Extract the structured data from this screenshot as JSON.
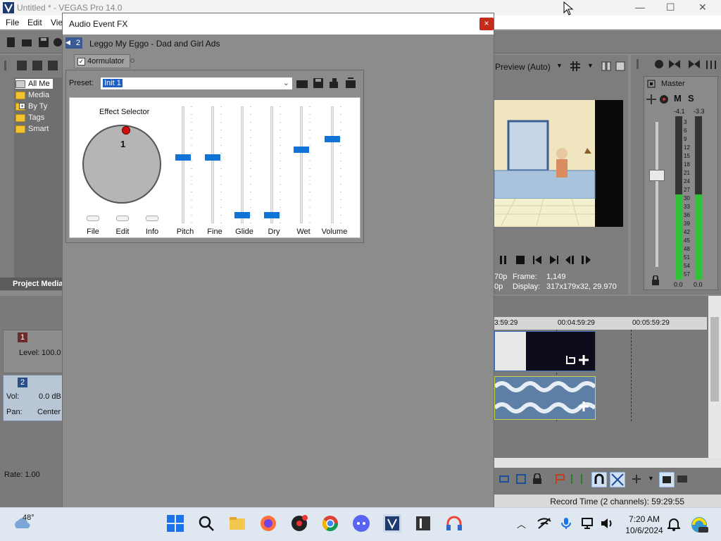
{
  "app": {
    "title": "Untitled * - VEGAS Pro 14.0",
    "menu": [
      "File",
      "Edit",
      "Vie"
    ]
  },
  "window_controls": {
    "minimize": "—",
    "maximize": "☐",
    "close": "✕"
  },
  "project_media": {
    "items": [
      "All Me",
      "Media",
      "By Ty",
      "Tags",
      "Smart"
    ],
    "label": "Project Media"
  },
  "tracks": [
    {
      "number": "1",
      "level_label": "Level:",
      "level_value": "100.0"
    },
    {
      "number": "2",
      "vol_label": "Vol:",
      "vol_value": "0.0 dB",
      "pan_label": "Pan:",
      "pan_value": "Center"
    }
  ],
  "rate": "Rate: 1.00",
  "preview": {
    "mode": "Preview (Auto)",
    "frame_label": "Frame:",
    "frame_value": "1,149",
    "display_label": "Display:",
    "display_value": "317x179x32, 29.970",
    "left_frag_1": "70p",
    "left_frag_2": "0p"
  },
  "master": {
    "title": "Master",
    "m_label": "M",
    "s_label": "S",
    "peak_left": "-4.1",
    "peak_right": "-3.3",
    "scale": [
      "3",
      "6",
      "9",
      "12",
      "15",
      "18",
      "21",
      "24",
      "27",
      "30",
      "33",
      "36",
      "39",
      "42",
      "45",
      "48",
      "51",
      "54",
      "57"
    ],
    "level_left": "0.0",
    "level_right": "0.0",
    "meter_left_fraction": 0.52,
    "meter_right_fraction": 0.52
  },
  "timeline": {
    "ruler": [
      "3:59:29",
      "00:04:59:29",
      "00:05:59:29"
    ],
    "record_time": "Record Time (2 channels): 59:29:55"
  },
  "dialog": {
    "title": "Audio Event FX",
    "close": "×",
    "chain_number": "2",
    "chain_title": "Leggo My Eggo - Dad and Girl Ads",
    "plugin_tab": "4ormulator",
    "preset_label": "Preset:",
    "preset_value": "Init 1",
    "effect_selector_label": "Effect Selector",
    "knob_value": "1",
    "buttons": [
      "File",
      "Edit",
      "Info"
    ],
    "sliders": [
      {
        "label": "Pitch",
        "value": 0.55
      },
      {
        "label": "Fine",
        "value": 0.55
      },
      {
        "label": "Glide",
        "value": 0.0
      },
      {
        "label": "Dry",
        "value": 0.0
      },
      {
        "label": "Wet",
        "value": 0.62
      },
      {
        "label": "Volume",
        "value": 0.72
      }
    ]
  },
  "taskbar": {
    "weather_temp": "48°",
    "time": "7:20 AM",
    "date": "10/6/2024"
  },
  "colors": {
    "accent_blue": "#1273d6",
    "meter_green": "#32c23a",
    "close_red": "#c42b1c"
  }
}
